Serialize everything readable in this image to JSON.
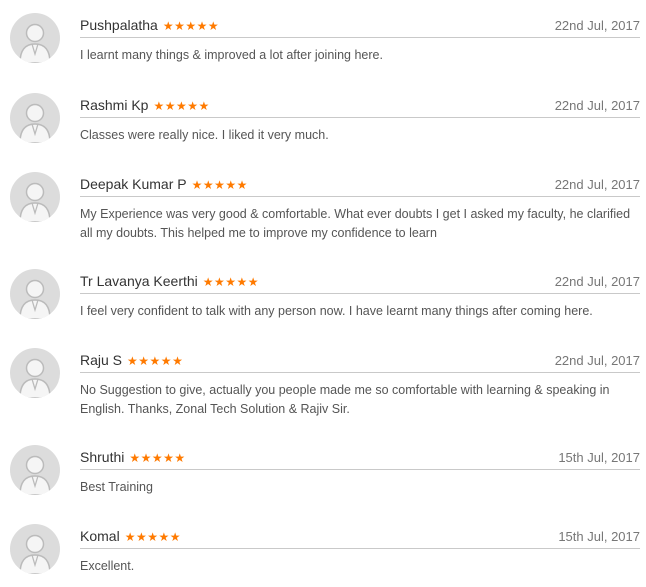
{
  "reviews": [
    {
      "name": "Pushpalatha",
      "stars": "★★★★★",
      "date": "22nd Jul, 2017",
      "text": "I learnt many things & improved a lot after joining here."
    },
    {
      "name": "Rashmi Kp",
      "stars": "★★★★★",
      "date": "22nd Jul, 2017",
      "text": "Classes were really nice. I liked it very much."
    },
    {
      "name": "Deepak Kumar P",
      "stars": "★★★★★",
      "date": "22nd Jul, 2017",
      "text": "My Experience was very good & comfortable. What ever doubts I get I asked my faculty, he clarified all my doubts. This helped me to improve my confidence to learn"
    },
    {
      "name": "Tr Lavanya Keerthi",
      "stars": "★★★★★",
      "date": "22nd Jul, 2017",
      "text": "I feel very confident to talk with any person now. I have learnt many things after coming here."
    },
    {
      "name": "Raju S",
      "stars": "★★★★★",
      "date": "22nd Jul, 2017",
      "text": "No Suggestion to give, actually you people made me so comfortable with learning & speaking in English. Thanks, Zonal Tech Solution & Rajiv Sir."
    },
    {
      "name": "Shruthi",
      "stars": "★★★★★",
      "date": "15th Jul, 2017",
      "text": "Best Training"
    },
    {
      "name": "Komal",
      "stars": "★★★★★",
      "date": "15th Jul, 2017",
      "text": "Excellent."
    }
  ],
  "icons": {
    "avatar": "user-avatar-icon",
    "star": "star-icon"
  },
  "colors": {
    "star": "#ff7a00",
    "avatar_bg": "#dcdcdc",
    "divider": "#c9c9c9"
  }
}
